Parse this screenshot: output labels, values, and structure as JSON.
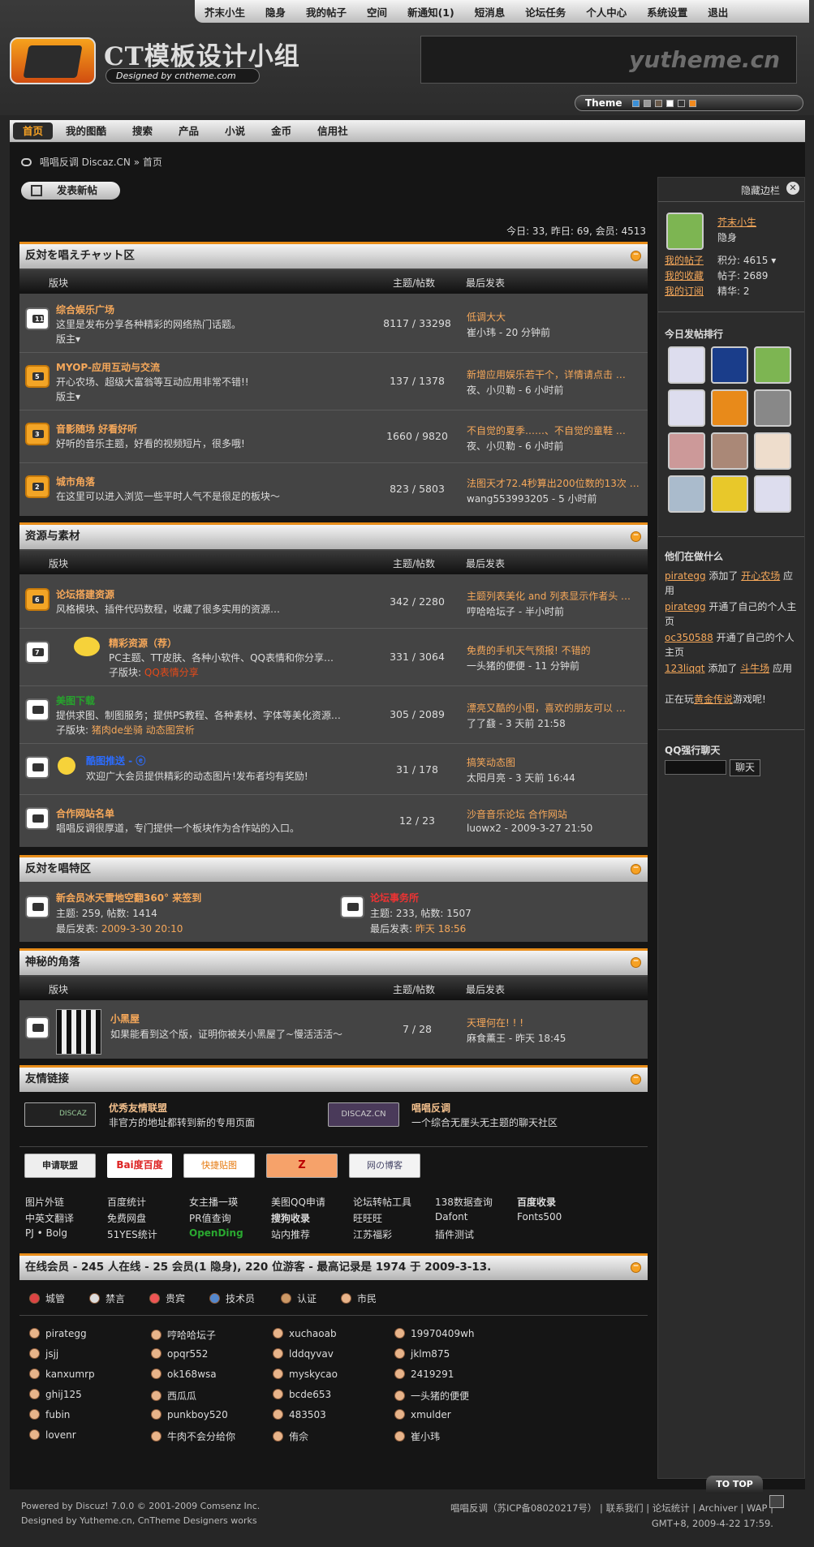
{
  "topnav": [
    "芥末小生",
    "隐身",
    "我的帖子",
    "空间",
    "新通知(1)",
    "短消息",
    "论坛任务",
    "个人中心",
    "系统设置",
    "退出"
  ],
  "logo": {
    "title": "CT模板设计小组",
    "subtitle": "Designed by cntheme.com"
  },
  "banner_text": "yutheme.cn",
  "theme": {
    "label": "Theme",
    "swatches": [
      "#3b8fd6",
      "#999999",
      "#6a5a4a",
      "#ffffff",
      "#333333",
      "#f28a1e"
    ]
  },
  "mainnav": [
    "首页",
    "我的图酷",
    "搜索",
    "产品",
    "小说",
    "金币",
    "信用社"
  ],
  "breadcrumb": {
    "site": "唱唱反调 Discaz.CN",
    "sep": "»",
    "current": "首页"
  },
  "newpost": "发表新帖",
  "stats": "今日: 33, 昨日: 69, 会员: 4513",
  "cols": {
    "forum": "版块",
    "threads": "主题/帖数",
    "last": "最后发表"
  },
  "cat1": {
    "title": "反対を唱えチャット区",
    "forums": [
      {
        "badge": "11",
        "name": "综合娱乐广场",
        "desc": "这里是发布分享各种精彩的网络热门话题。",
        "mod": "版主▾",
        "count": "8117 / 33298",
        "last": "低调大大",
        "who": "崔小玮 - 20 分钟前"
      },
      {
        "badge": "5",
        "name": "MYOP-应用互动与交流",
        "desc": "开心农场、超级大富翁等互动应用非常不错!!",
        "mod": "版主▾",
        "count": "137 / 1378",
        "last": "新增应用娱乐若干个，详情请点击 …",
        "who": "夜、小贝勒 - 6 小时前"
      },
      {
        "badge": "3",
        "name": "音影随场  好看好听",
        "desc": "好听的音乐主题，好看的视频短片，很多哦!",
        "count": "1660 / 9820",
        "last": "不自觉的夏季……、不自觉的童鞋 …",
        "who": "夜、小贝勒 - 6 小时前"
      },
      {
        "badge": "2",
        "name": "城市角落",
        "desc": "在这里可以进入浏览一些平时人气不是很足的板块～",
        "count": "823 / 5803",
        "last": "法图天才72.4秒算出200位数的13次 …",
        "who": "wang553993205 - 5 小时前"
      }
    ]
  },
  "cat2": {
    "title": "资源与素材",
    "forums": [
      {
        "badge": "6",
        "name": "论坛搭建资源",
        "desc": "风格模块、插件代码数程，收藏了很多实用的资源…",
        "count": "342 / 2280",
        "last": "主题列表美化 and 列表显示作者头 …",
        "who": "哼哈哈坛子 - 半小时前"
      },
      {
        "badge": "7",
        "name": "精彩资源（荐）",
        "desc": "PC主题、TT皮肤、各种小软件、QQ表情和你分享…",
        "sub_label": "子版块:",
        "sub": "QQ表情分享",
        "count": "331 / 3064",
        "last": "免费的手机天气预报! 不错的",
        "who": "一头猪的便便 - 11 分钟前"
      },
      {
        "badge": "",
        "name": "美图下载",
        "desc": "提供求图、制图服务；提供PS教程、各种素材、字体等美化资源…",
        "sub_label": "子版块:",
        "sub": "猪肉de坐骑  动态图赏析",
        "count": "305 / 2089",
        "last": "漂亮又酷的小图，喜欢的朋友可以 …",
        "who": "了了鼗 - 3 天前 21:58"
      },
      {
        "badge": "",
        "name": "酷图推送 - ⓔ",
        "desc": "欢迎广大会员提供精彩的动态图片!发布者均有奖励!",
        "count": "31 / 178",
        "last": "搞笑动态图",
        "who": "太阳月亮 - 3 天前 16:44"
      },
      {
        "badge": "",
        "name": "合作网站名单",
        "desc": "唱唱反调很厚道，专门提供一个板块作为合作站的入口。",
        "count": "12 / 23",
        "last": "沙音音乐论坛 合作网站",
        "who": "luowx2 - 2009-3-27 21:50"
      }
    ]
  },
  "cat3": {
    "title": "反対を唱特区",
    "forums": [
      {
        "name": "新会员冰天雪地空翻360° 来签到",
        "line1": "主题: 259, 帖数: 1414",
        "line2_label": "最后发表:",
        "line2": "2009-3-30 20:10"
      },
      {
        "name": "论坛事务所",
        "line1": "主题: 233, 帖数: 1507",
        "line2_label": "最后发表:",
        "line2": "昨天 18:56"
      }
    ]
  },
  "cat4": {
    "title": "神秘的角落",
    "forum": {
      "name": "小黑屋",
      "desc": "如果能看到这个版，证明你被关小黑屋了~慢活活活～",
      "count": "7 / 28",
      "last": "天理何在! ! !",
      "who": "麻食薰王 - 昨天 18:45"
    }
  },
  "links": {
    "title": "友情链接",
    "big": [
      {
        "logo": "DISCAZ",
        "name": "优秀友情联盟",
        "desc": "非官方的地址都转到新的专用页面"
      },
      {
        "logo": "DISCAZ.CN",
        "name": "唱唱反调",
        "desc": "一个综合无厘头无主题的聊天社区"
      }
    ],
    "logos": [
      "申请联盟",
      "Bai度百度",
      "快捷贴图",
      "Z",
      "网の博客"
    ],
    "text": [
      [
        "图片外链",
        "百度统计",
        "女主播一瑛",
        "美图QQ申请",
        "论坛转帖工具",
        "138数据查询",
        "百度收录"
      ],
      [
        "中英文翻译",
        "免费网盘",
        "PR值查询",
        "搜狗收录",
        "旺旺旺",
        "Dafont",
        "Fonts500"
      ],
      [
        "PJ • Bolg",
        "51YES统计",
        "OpenDing",
        "站内推荐",
        "江苏福彩",
        "插件测试"
      ]
    ]
  },
  "online": {
    "title": "在线会员 - 245 人在线 - 25 会员(1 隐身), 220 位游客 - 最高记录是 1974 于 2009-3-13.",
    "legend": [
      "城管",
      "禁言",
      "贵宾",
      "技术员",
      "认证",
      "市民"
    ],
    "users": [
      [
        "pirategg",
        "哼哈哈坛子",
        "xuchaoab",
        "19970409wh"
      ],
      [
        "jsjj",
        "opqr552",
        "lddqyvav",
        "jklm875"
      ],
      [
        "kanxumrp",
        "ok168wsa",
        "myskycao",
        "2419291"
      ],
      [
        "ghij125",
        "西瓜瓜",
        "bcde653",
        "一头猪的便便"
      ],
      [
        "fubin",
        "punkboy520",
        "483503",
        "xmulder"
      ],
      [
        "lovenr",
        "牛肉不会分给你",
        "侑佘",
        "崔小玮"
      ]
    ]
  },
  "side": {
    "hide": "隐藏边栏",
    "user": "芥末小生",
    "status": "隐身",
    "links": [
      "我的帖子",
      "我的收藏",
      "我的订阅"
    ],
    "score": "积分: 4615 ▾",
    "posts": "帖子: 2689",
    "digest": "精华: 2",
    "rank_title": "今日发帖排行",
    "doing_title": "他们在做什么",
    "doing": [
      {
        "u": "pirategg",
        "t": " 添加了 ",
        "l": "开心农场",
        "r": " 应用"
      },
      {
        "u": "pirategg",
        "t": " 开通了自己的个人主页"
      },
      {
        "u": "oc350588",
        "t": " 开通了自己的个人主页"
      },
      {
        "u": "123liqqt",
        "t": " 添加了 ",
        "l": "斗牛场",
        "r": " 应用"
      },
      {
        "p": "正在玩",
        "l": "黄金传说",
        "r": "游戏呢!"
      }
    ],
    "qq_title": "QQ强行聊天",
    "qq_btn": "聊天"
  },
  "totop": "TO TOP",
  "footer": {
    "l1": "Powered by Discuz! 7.0.0 © 2001-2009 Comsenz Inc.",
    "l2": "Designed by Yutheme.cn, CnTheme Designers works",
    "r1": "唱唱反调（苏ICP备08020217号） | 联系我们  |  论坛统计 | Archiver | WAP |",
    "r2": "GMT+8, 2009-4-22 17:59."
  }
}
